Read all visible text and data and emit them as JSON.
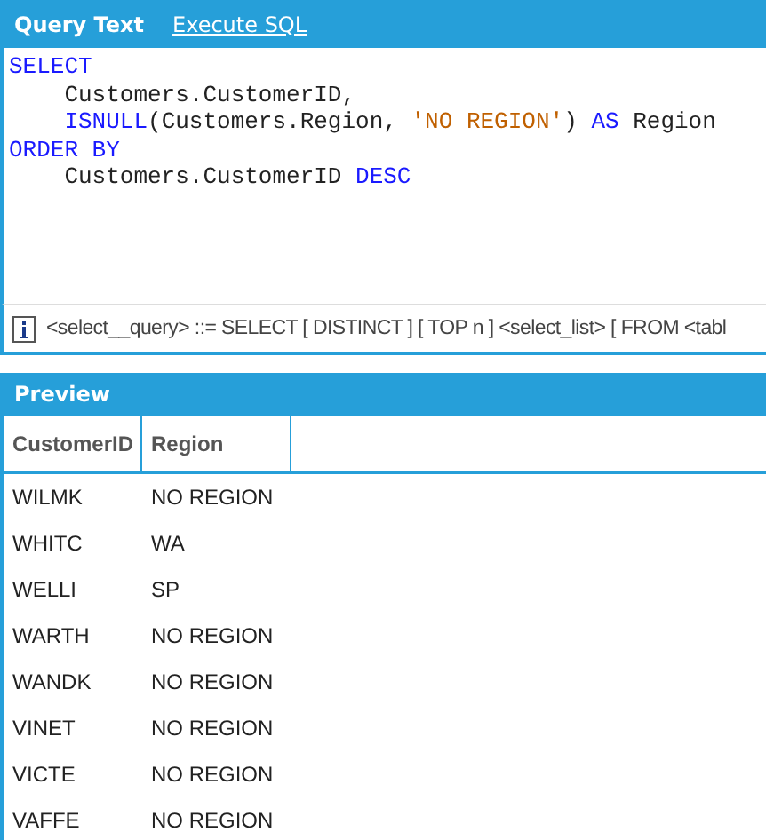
{
  "tabs": [
    {
      "label": "Query Text",
      "selected": true
    },
    {
      "label": "Execute SQL",
      "selected": false
    }
  ],
  "editor": {
    "lines": [
      {
        "indented": false,
        "tokens": [
          {
            "kind": "keyword",
            "text": "SELECT"
          }
        ]
      },
      {
        "indented": true,
        "tokens": [
          {
            "kind": "plain",
            "text": "Customers.CustomerID,"
          }
        ]
      },
      {
        "indented": true,
        "tokens": [
          {
            "kind": "keyword",
            "text": "ISNULL"
          },
          {
            "kind": "plain",
            "text": "(Customers.Region, "
          },
          {
            "kind": "string",
            "text": "'NO REGION'"
          },
          {
            "kind": "plain",
            "text": ") "
          },
          {
            "kind": "keyword",
            "text": "AS"
          },
          {
            "kind": "plain",
            "text": " Region"
          }
        ]
      },
      {
        "indented": false,
        "tokens": [
          {
            "kind": "keyword",
            "text": "ORDER BY"
          }
        ]
      },
      {
        "indented": true,
        "tokens": [
          {
            "kind": "plain",
            "text": "Customers.CustomerID "
          },
          {
            "kind": "keyword",
            "text": "DESC"
          }
        ]
      }
    ]
  },
  "hint": {
    "text": "<select__query> ::= SELECT [ DISTINCT ] [ TOP n ] <select_list> [ FROM <tabl"
  },
  "preview": {
    "title": "Preview",
    "columns": [
      "CustomerID",
      "Region"
    ],
    "rows": [
      [
        "WILMK",
        "NO REGION"
      ],
      [
        "WHITC",
        "WA"
      ],
      [
        "WELLI",
        "SP"
      ],
      [
        "WARTH",
        "NO REGION"
      ],
      [
        "WANDK",
        "NO REGION"
      ],
      [
        "VINET",
        "NO REGION"
      ],
      [
        "VICTE",
        "NO REGION"
      ],
      [
        "VAFFE",
        "NO REGION"
      ]
    ]
  }
}
